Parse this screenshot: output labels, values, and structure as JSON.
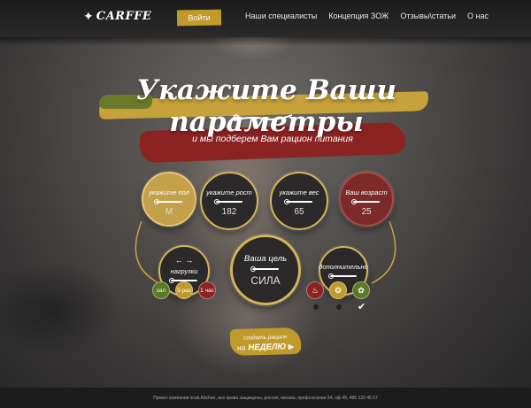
{
  "header": {
    "logo": "CARFFE",
    "login": "Войти",
    "nav": [
      "Наши специалисты",
      "Концепция ЗОЖ",
      "Отзывы\\статьи",
      "О нас"
    ]
  },
  "hero": {
    "title": "Укажите Ваши параметры",
    "subtitle": "и мы подберем Вам рацион питания"
  },
  "params": {
    "sex": {
      "label": "укажите пол",
      "value": "М"
    },
    "height": {
      "label": "укажите рост",
      "value": "182"
    },
    "weight": {
      "label": "укажите вес",
      "value": "65"
    },
    "age": {
      "label": "Ваш возраст",
      "value": "25"
    },
    "load": {
      "label": "нагрузки",
      "arrows": "← →"
    },
    "goal": {
      "label": "Ваша цель",
      "value": "СИЛА"
    },
    "extra": {
      "label": "дополнительно"
    }
  },
  "load_options": [
    "зал",
    "5 раз",
    "1 час"
  ],
  "extra_icons": [
    "meat-icon",
    "fish-icon",
    "carrot-icon"
  ],
  "cta": {
    "line1": "создать рацион",
    "line2": "на",
    "line3": "НЕДЕЛЮ"
  },
  "footer": {
    "brand": "snaiLKitchen",
    "text": "Проект компании snaiLKitchen, все права защищены, россия, москва, профсоюзная 24, оф.45, 495 123 45 67"
  }
}
